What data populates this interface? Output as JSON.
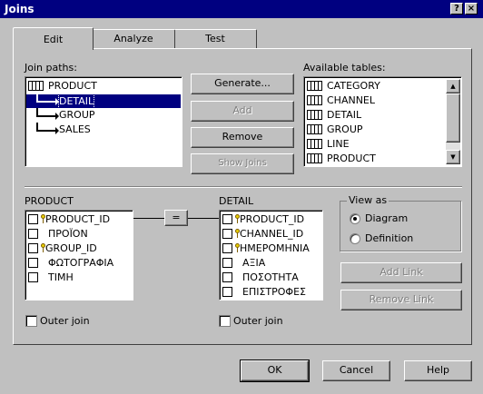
{
  "window": {
    "title": "Joins",
    "help_button": "?",
    "close_button": "×"
  },
  "tabs": [
    {
      "label": "Edit"
    },
    {
      "label": "Analyze"
    },
    {
      "label": "Test"
    }
  ],
  "join_paths": {
    "label": "Join paths:",
    "items": [
      {
        "label": "PRODUCT"
      },
      {
        "label": "DETAIL"
      },
      {
        "label": "GROUP"
      },
      {
        "label": "SALES"
      }
    ]
  },
  "buttons": {
    "generate": "Generate...",
    "add": "Add",
    "remove": "Remove",
    "show_joins": "Show Joins",
    "add_link": "Add Link",
    "remove_link": "Remove Link",
    "ok": "OK",
    "cancel": "Cancel",
    "help": "Help"
  },
  "available_tables": {
    "label": "Available tables:",
    "items": [
      {
        "label": "CATEGORY"
      },
      {
        "label": "CHANNEL"
      },
      {
        "label": "DETAIL"
      },
      {
        "label": "GROUP"
      },
      {
        "label": "LINE"
      },
      {
        "label": "PRODUCT"
      }
    ]
  },
  "left_table": {
    "name": "PRODUCT",
    "fields": [
      {
        "label": "PRODUCT_ID",
        "key": true
      },
      {
        "label": "ΠΡΟΪΟΝ",
        "key": false
      },
      {
        "label": "GROUP_ID",
        "key": true
      },
      {
        "label": "ΦΩΤΟΓΡΑΦΙΑ",
        "key": false
      },
      {
        "label": "ΤΙΜΗ",
        "key": false
      }
    ],
    "outer_join": "Outer join"
  },
  "right_table": {
    "name": "DETAIL",
    "fields": [
      {
        "label": "PRODUCT_ID",
        "key": true
      },
      {
        "label": "CHANNEL_ID",
        "key": true
      },
      {
        "label": "ΗΜΕΡΟΜΗΝΙΑ",
        "key": true
      },
      {
        "label": "ΑΞΙΑ",
        "key": false
      },
      {
        "label": "ΠΟΣΟΤΗΤΑ",
        "key": false
      },
      {
        "label": "ΕΠΙΣΤΡΟΦΕΣ",
        "key": false
      }
    ],
    "outer_join": "Outer join"
  },
  "join_operator": "=",
  "view_as": {
    "label": "View as",
    "options": [
      {
        "label": "Diagram"
      },
      {
        "label": "Definition"
      }
    ],
    "selected": "Diagram"
  }
}
